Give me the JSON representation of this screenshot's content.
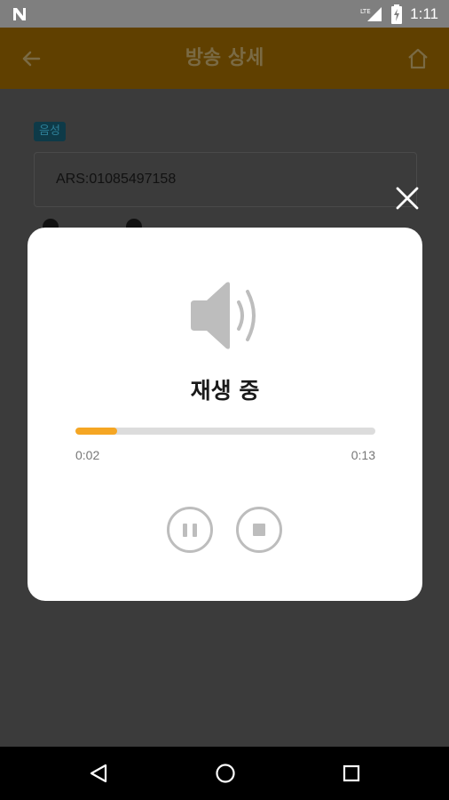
{
  "status_bar": {
    "network": "LTE",
    "time": "1:11"
  },
  "app_bar": {
    "title": "방송 상세",
    "back_icon": "arrow-left-icon",
    "home_icon": "home-icon"
  },
  "background": {
    "type_badge": "음성",
    "ars_number": "ARS:01085497158"
  },
  "dialog": {
    "speaker_icon": "speaker-icon",
    "status": "재생 중",
    "progress_fraction": 0.14,
    "current_time": "0:02",
    "total_time": "0:13",
    "colors": {
      "progress": "#f5a623",
      "track": "#dcdcdc"
    },
    "controls": [
      "pause-icon",
      "stop-icon"
    ]
  },
  "nav": {
    "icons": [
      "back-triangle-icon",
      "home-circle-icon",
      "recents-square-icon"
    ]
  }
}
